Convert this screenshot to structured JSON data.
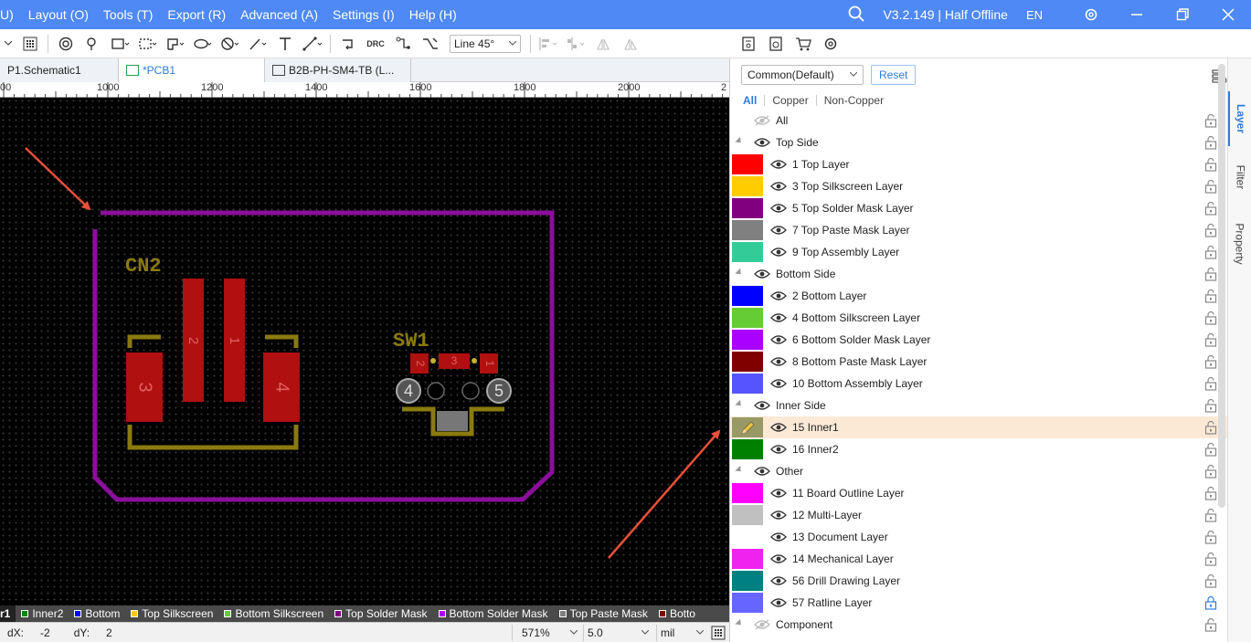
{
  "menubar": {
    "items": [
      "U)",
      "Layout (O)",
      "Tools (T)",
      "Export (R)",
      "Advanced (A)",
      "Settings (I)",
      "Help (H)"
    ],
    "version": "V3.2.149 | Half Offline",
    "language": "EN"
  },
  "toolbar": {
    "drc_label": "DRC",
    "line_mode": "Line 45°"
  },
  "doc_tabs": [
    {
      "label": "P1.Schematic1"
    },
    {
      "label": "*PCB1"
    },
    {
      "label": "B2B-PH-SM4-TB (L..."
    }
  ],
  "ruler": {
    "labels": [
      "00",
      "1000",
      "1200",
      "1400",
      "1600",
      "1800",
      "2000",
      "2"
    ]
  },
  "pcb": {
    "designators": [
      "CN2",
      "SW1"
    ],
    "pad_numbers": [
      "3",
      "2",
      "1",
      "4",
      "2",
      "3",
      "1",
      "4",
      "5"
    ]
  },
  "layer_bar": [
    {
      "label": "r1",
      "color": "#888888"
    },
    {
      "label": "Inner2",
      "color": "#008a00"
    },
    {
      "label": "Bottom",
      "color": "#0000ff"
    },
    {
      "label": "Top Silkscreen",
      "color": "#ffcc00"
    },
    {
      "label": "Bottom Silkscreen",
      "color": "#66cc33"
    },
    {
      "label": "Top Solder Mask",
      "color": "#800080"
    },
    {
      "label": "Bottom Solder Mask",
      "color": "#aa00ff"
    },
    {
      "label": "Top Paste Mask",
      "color": "#808080"
    },
    {
      "label": "Botto",
      "color": "#800000"
    }
  ],
  "status": {
    "dx_label": "dX:",
    "dx_value": "-2",
    "dy_label": "dY:",
    "dy_value": "2",
    "zoom": "571%",
    "grid": "5.0",
    "unit": "mil"
  },
  "panel": {
    "preset": "Common(Default)",
    "reset_label": "Reset",
    "filter_tabs": [
      "All",
      "Copper",
      "Non-Copper"
    ],
    "layers": [
      {
        "type": "all",
        "label": "All"
      },
      {
        "type": "group",
        "label": "Top Side"
      },
      {
        "type": "layer",
        "label": "1 Top Layer",
        "color": "#ff0000"
      },
      {
        "type": "layer",
        "label": "3 Top Silkscreen Layer",
        "color": "#ffcc00"
      },
      {
        "type": "layer",
        "label": "5 Top Solder Mask Layer",
        "color": "#800080"
      },
      {
        "type": "layer",
        "label": "7 Top Paste Mask Layer",
        "color": "#808080"
      },
      {
        "type": "layer",
        "label": "9 Top Assembly Layer",
        "color": "#33cc99"
      },
      {
        "type": "group",
        "label": "Bottom Side"
      },
      {
        "type": "layer",
        "label": "2 Bottom Layer",
        "color": "#0000ff"
      },
      {
        "type": "layer",
        "label": "4 Bottom Silkscreen Layer",
        "color": "#66cc33"
      },
      {
        "type": "layer",
        "label": "6 Bottom Solder Mask Layer",
        "color": "#aa00ff"
      },
      {
        "type": "layer",
        "label": "8 Bottom Paste Mask Layer",
        "color": "#800000"
      },
      {
        "type": "layer",
        "label": "10 Bottom Assembly Layer",
        "color": "#5555ff"
      },
      {
        "type": "group",
        "label": "Inner Side"
      },
      {
        "type": "layer",
        "label": "15 Inner1",
        "color": "#999966",
        "active": true
      },
      {
        "type": "layer",
        "label": "16 Inner2",
        "color": "#008000"
      },
      {
        "type": "group",
        "label": "Other"
      },
      {
        "type": "layer",
        "label": "11 Board Outline Layer",
        "color": "#ff00ff"
      },
      {
        "type": "layer",
        "label": "12 Multi-Layer",
        "color": "#c0c0c0"
      },
      {
        "type": "layer",
        "label": "13 Document Layer",
        "color": "#ffffff"
      },
      {
        "type": "layer",
        "label": "14 Mechanical Layer",
        "color": "#f022f0"
      },
      {
        "type": "layer",
        "label": "56 Drill Drawing Layer",
        "color": "#008080"
      },
      {
        "type": "layer",
        "label": "57 Ratline Layer",
        "color": "#6666ff",
        "locked_blue": true
      },
      {
        "type": "group",
        "label": "Component"
      }
    ]
  },
  "side_tabs": [
    "Layer",
    "Filter",
    "Property"
  ]
}
